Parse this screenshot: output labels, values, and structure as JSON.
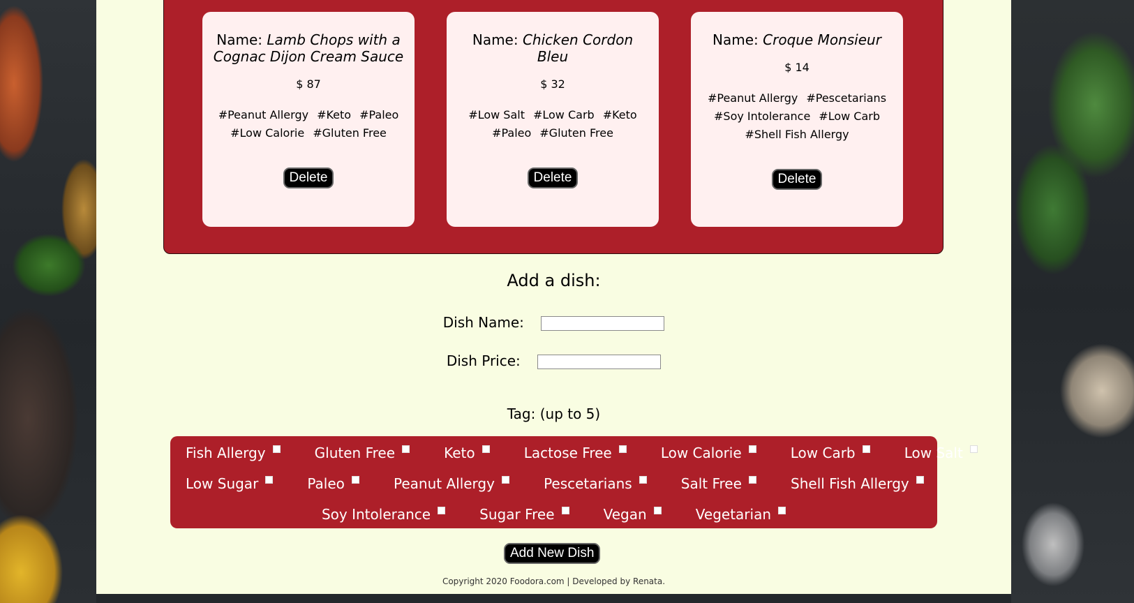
{
  "dishes": [
    {
      "name_label": "Name: ",
      "name": "Lamb Chops with a Cognac Dijon Cream Sauce",
      "price": "$ 87",
      "tags": [
        "#Peanut Allergy",
        "#Keto",
        "#Paleo",
        "#Low Calorie",
        "#Gluten Free"
      ],
      "delete_label": "Delete"
    },
    {
      "name_label": "Name: ",
      "name": "Chicken Cordon Bleu",
      "price": "$ 32",
      "tags": [
        "#Low Salt",
        "#Low Carb",
        "#Keto",
        "#Paleo",
        "#Gluten Free"
      ],
      "delete_label": "Delete"
    },
    {
      "name_label": "Name: ",
      "name": "Croque Monsieur",
      "price": "$ 14",
      "tags": [
        "#Peanut Allergy",
        "#Pescetarians",
        "#Soy Intolerance",
        "#Low Carb",
        "#Shell Fish Allergy"
      ],
      "delete_label": "Delete"
    }
  ],
  "form": {
    "title": "Add a dish:",
    "dish_name_label": "Dish Name:",
    "dish_name_value": "",
    "dish_price_label": "Dish Price:",
    "dish_price_value": "",
    "tag_label": "Tag: (up to 5)",
    "tag_rows": [
      [
        "Fish Allergy",
        "Gluten Free",
        "Keto",
        "Lactose Free",
        "Low Calorie",
        "Low Carb",
        "Low Salt"
      ],
      [
        "Low Sugar",
        "Paleo",
        "Peanut Allergy",
        "Pescetarians",
        "Salt Free",
        "Shell Fish Allergy"
      ],
      [
        "Soy Intolerance",
        "Sugar Free",
        "Vegan",
        "Vegetarian"
      ]
    ],
    "submit_label": "Add New Dish"
  },
  "footer": {
    "text": "Copyright 2020 Foodora.com | Developed by Renata."
  },
  "colors": {
    "panel": "#ad1f29",
    "page": "#f9fde2",
    "card": "#fff0f0"
  }
}
